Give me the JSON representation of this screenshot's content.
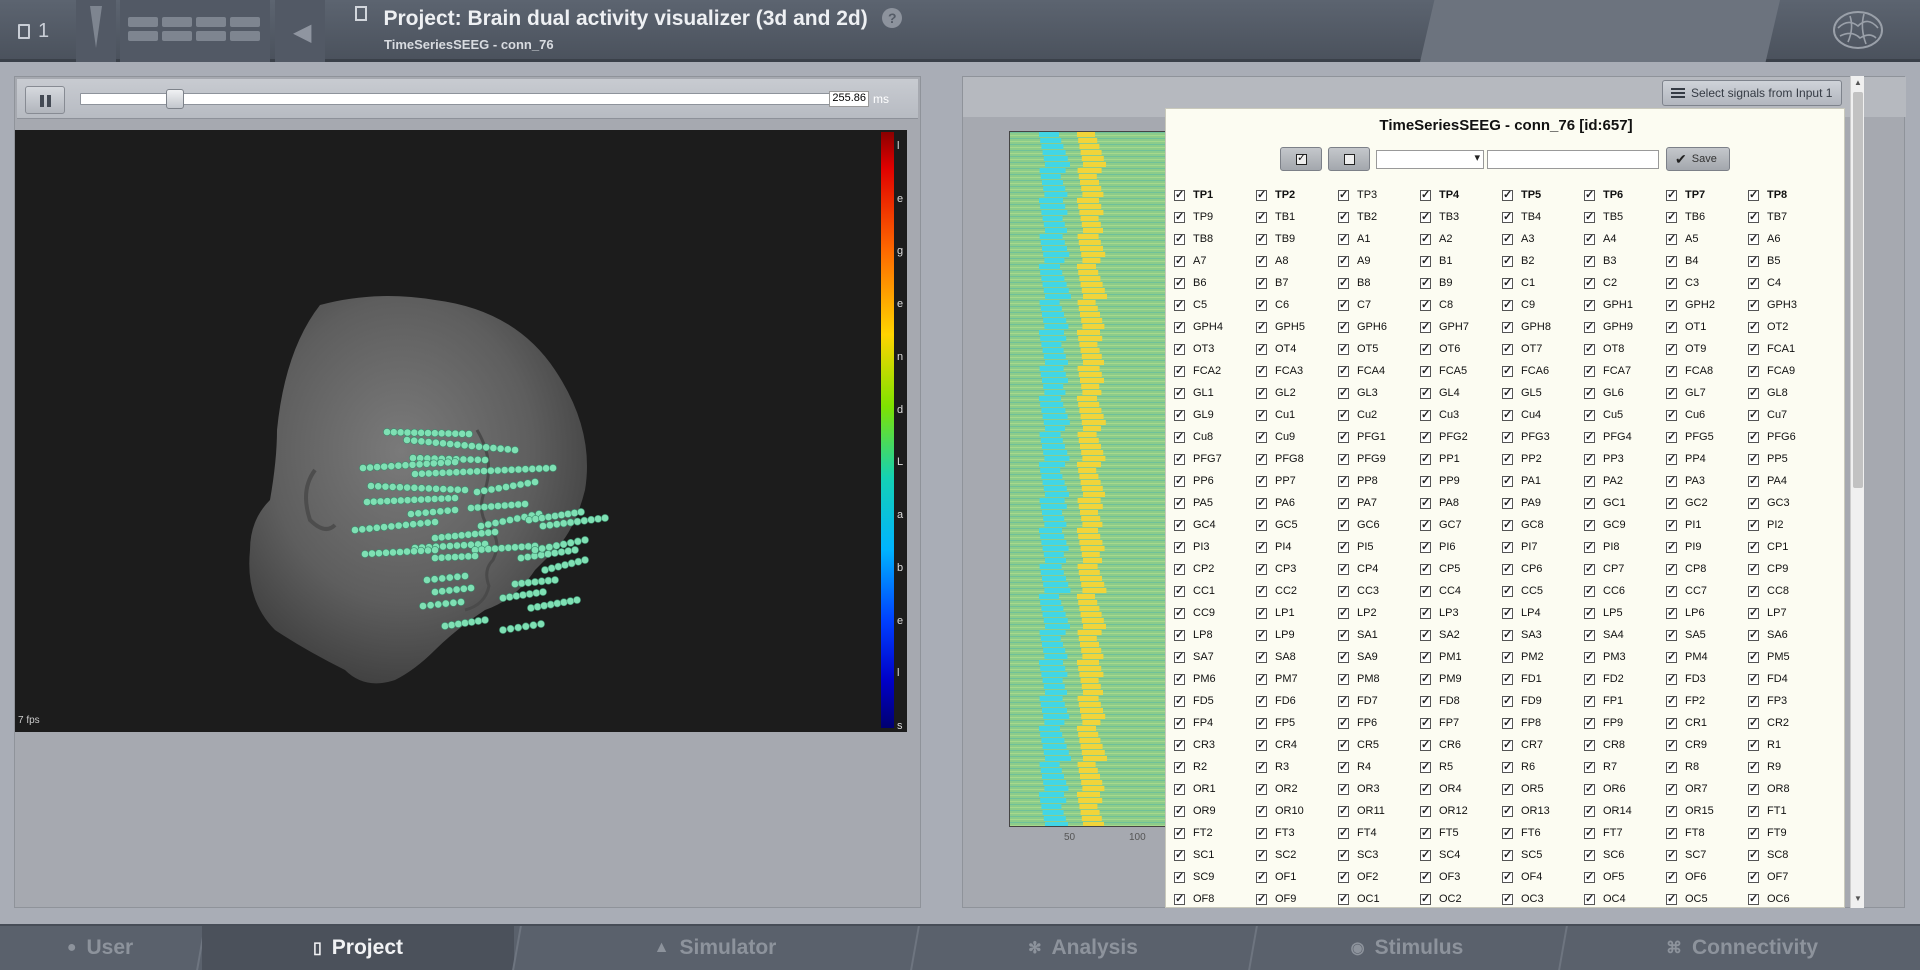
{
  "header": {
    "project_count": "1",
    "title": "Project: Brain dual activity visualizer (3d and 2d)",
    "subtitle": "TimeSeriesSEEG - conn_76",
    "help_glyph": "?"
  },
  "player": {
    "time_value": "255.86",
    "time_unit": "ms",
    "slider_fraction": 0.115,
    "fps": "7 fps"
  },
  "colorbar": {
    "labels": [
      "l",
      "e",
      "g",
      "e",
      "n",
      "d",
      "L",
      "a",
      "b",
      "e",
      "l",
      "s"
    ]
  },
  "heatmap": {
    "x_ticks": [
      "50",
      "100"
    ]
  },
  "selector": {
    "button_label": "Select signals from Input 1",
    "title": "TimeSeriesSEEG - conn_76 [id:657]",
    "save_label": "Save",
    "name_value": "",
    "channels": [
      "TP1",
      "TP2",
      "TP3",
      "TP4",
      "TP5",
      "TP6",
      "TP7",
      "TP8",
      "TP9",
      "TB1",
      "TB2",
      "TB3",
      "TB4",
      "TB5",
      "TB6",
      "TB7",
      "TB8",
      "TB9",
      "A1",
      "A2",
      "A3",
      "A4",
      "A5",
      "A6",
      "A7",
      "A8",
      "A9",
      "B1",
      "B2",
      "B3",
      "B4",
      "B5",
      "B6",
      "B7",
      "B8",
      "B9",
      "C1",
      "C2",
      "C3",
      "C4",
      "C5",
      "C6",
      "C7",
      "C8",
      "C9",
      "GPH1",
      "GPH2",
      "GPH3",
      "GPH4",
      "GPH5",
      "GPH6",
      "GPH7",
      "GPH8",
      "GPH9",
      "OT1",
      "OT2",
      "OT3",
      "OT4",
      "OT5",
      "OT6",
      "OT7",
      "OT8",
      "OT9",
      "FCA1",
      "FCA2",
      "FCA3",
      "FCA4",
      "FCA5",
      "FCA6",
      "FCA7",
      "FCA8",
      "FCA9",
      "GL1",
      "GL2",
      "GL3",
      "GL4",
      "GL5",
      "GL6",
      "GL7",
      "GL8",
      "GL9",
      "Cu1",
      "Cu2",
      "Cu3",
      "Cu4",
      "Cu5",
      "Cu6",
      "Cu7",
      "Cu8",
      "Cu9",
      "PFG1",
      "PFG2",
      "PFG3",
      "PFG4",
      "PFG5",
      "PFG6",
      "PFG7",
      "PFG8",
      "PFG9",
      "PP1",
      "PP2",
      "PP3",
      "PP4",
      "PP5",
      "PP6",
      "PP7",
      "PP8",
      "PP9",
      "PA1",
      "PA2",
      "PA3",
      "PA4",
      "PA5",
      "PA6",
      "PA7",
      "PA8",
      "PA9",
      "GC1",
      "GC2",
      "GC3",
      "GC4",
      "GC5",
      "GC6",
      "GC7",
      "GC8",
      "GC9",
      "PI1",
      "PI2",
      "PI3",
      "PI4",
      "PI5",
      "PI6",
      "PI7",
      "PI8",
      "PI9",
      "CP1",
      "CP2",
      "CP3",
      "CP4",
      "CP5",
      "CP6",
      "CP7",
      "CP8",
      "CP9",
      "CC1",
      "CC2",
      "CC3",
      "CC4",
      "CC5",
      "CC6",
      "CC7",
      "CC8",
      "CC9",
      "LP1",
      "LP2",
      "LP3",
      "LP4",
      "LP5",
      "LP6",
      "LP7",
      "LP8",
      "LP9",
      "SA1",
      "SA2",
      "SA3",
      "SA4",
      "SA5",
      "SA6",
      "SA7",
      "SA8",
      "SA9",
      "PM1",
      "PM2",
      "PM3",
      "PM4",
      "PM5",
      "PM6",
      "PM7",
      "PM8",
      "PM9",
      "FD1",
      "FD2",
      "FD3",
      "FD4",
      "FD5",
      "FD6",
      "FD7",
      "FD8",
      "FD9",
      "FP1",
      "FP2",
      "FP3",
      "FP4",
      "FP5",
      "FP6",
      "FP7",
      "FP8",
      "FP9",
      "CR1",
      "CR2",
      "CR3",
      "CR4",
      "CR5",
      "CR6",
      "CR7",
      "CR8",
      "CR9",
      "R1",
      "R2",
      "R3",
      "R4",
      "R5",
      "R6",
      "R7",
      "R8",
      "R9",
      "OR1",
      "OR2",
      "OR3",
      "OR4",
      "OR5",
      "OR6",
      "OR7",
      "OR8",
      "OR9",
      "OR10",
      "OR11",
      "OR12",
      "OR13",
      "OR14",
      "OR15",
      "FT1",
      "FT2",
      "FT3",
      "FT4",
      "FT5",
      "FT6",
      "FT7",
      "FT8",
      "FT9",
      "SC1",
      "SC2",
      "SC3",
      "SC4",
      "SC5",
      "SC6",
      "SC7",
      "SC8",
      "SC9",
      "OF1",
      "OF2",
      "OF3",
      "OF4",
      "OF5",
      "OF6",
      "OF7",
      "OF8",
      "OF9",
      "OC1",
      "OC2",
      "OC3",
      "OC4",
      "OC5",
      "OC6"
    ],
    "bold_channels": [
      "TP1",
      "TP2",
      "TP4",
      "TP5",
      "TP6",
      "TP7",
      "TP8"
    ]
  },
  "nav": {
    "tabs": [
      {
        "label": "User",
        "icon": "user-icon"
      },
      {
        "label": "Project",
        "icon": "document-icon"
      },
      {
        "label": "Simulator",
        "icon": "flask-icon"
      },
      {
        "label": "Analysis",
        "icon": "gear-icon"
      },
      {
        "label": "Stimulus",
        "icon": "location-pin-icon"
      },
      {
        "label": "Connectivity",
        "icon": "network-icon"
      }
    ],
    "active": "Project"
  },
  "colors": {
    "heat_cyan": "#42d6e6",
    "heat_yellow": "#f1d43a",
    "heat_green": "#8ccc8a",
    "electrode": "#7fe0b4"
  }
}
